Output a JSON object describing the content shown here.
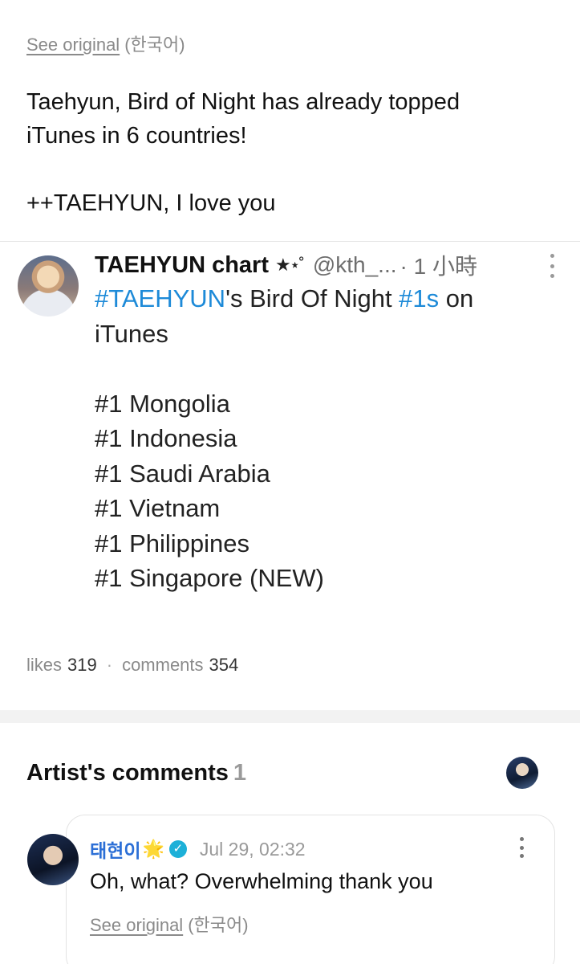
{
  "post": {
    "see_original_link": "See original",
    "see_original_lang": "(한국어)",
    "text_lines": [
      "Taehyun, Bird of Night has already topped",
      "iTunes in 6 countries!",
      "",
      "++TAEHYUN, I love you"
    ]
  },
  "embed": {
    "author_name": "TAEHYUN chart",
    "author_stars": "★⋆˚",
    "handle": "@kth_...",
    "time": "· 1 小時",
    "line1_tag1": "#TAEHYUN",
    "line1_text": "'s Bird Of Night ",
    "line1_tag2": "#1s",
    "line1_tail": " on",
    "line2": "iTunes",
    "rankings": [
      "#1 Mongolia",
      "#1 Indonesia",
      "#1 Saudi Arabia",
      "#1 Vietnam",
      "#1 Philippines",
      "#1 Singapore (NEW)"
    ]
  },
  "stats": {
    "likes_label": "likes",
    "likes_value": "319",
    "separator": "·",
    "comments_label": "comments",
    "comments_value": "354"
  },
  "artist_comments": {
    "heading": "Artist's comments",
    "count": "1",
    "comment": {
      "name": "태현이",
      "emoji": "🌟",
      "verified_glyph": "✓",
      "date": "Jul 29, 02:32",
      "text": "Oh, what? Overwhelming thank you",
      "see_original_link": "See original",
      "see_original_lang": "(한국어)"
    }
  },
  "colors": {
    "hashtag": "#1d8ad8",
    "artist_name": "#2c6fd6",
    "verified_badge": "#1db0d8",
    "muted_text": "#8a8a8a"
  }
}
